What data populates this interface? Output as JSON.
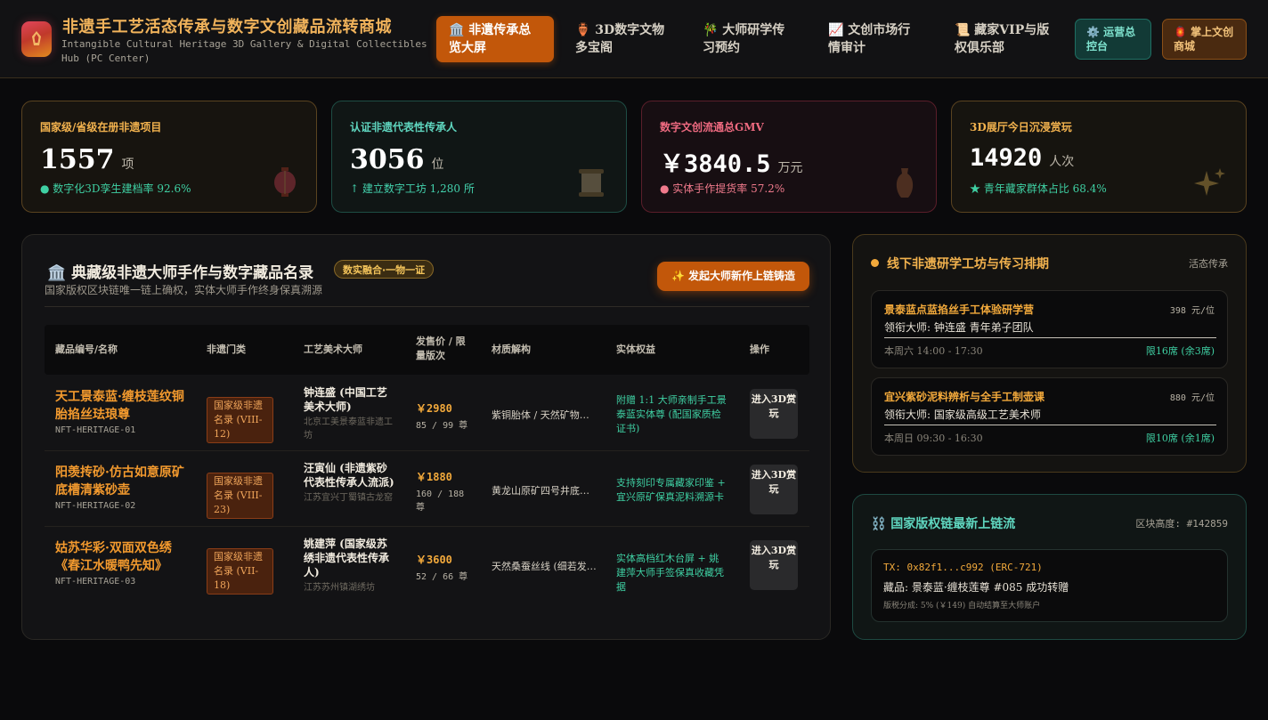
{
  "brand": {
    "title": "非遗手工艺活态传承与数字文创藏品流转商城",
    "subtitle": "Intangible Cultural Heritage 3D Gallery & Digital Collectibles Hub (PC Center)"
  },
  "nav": [
    {
      "label": "🏛️ 非遺传承总览大屏",
      "active": true
    },
    {
      "label": "🏺 3D数字文物多宝阁",
      "active": false
    },
    {
      "label": "🎋 大师研学传习预约",
      "active": false
    },
    {
      "label": "📈 文创市场行情审计",
      "active": false
    },
    {
      "label": "📜 藏家VIP与版权俱乐部",
      "active": false
    }
  ],
  "header_buttons": {
    "ops": "⚙️ 运营总控台",
    "mall": "🏮 掌上文创商城"
  },
  "stats": [
    {
      "label": "国家级/省级在册非遗项目",
      "value": "1557",
      "unit": "项",
      "foot": "● 数字化3D孪生建档率 92.6%",
      "icon": "lantern-icon"
    },
    {
      "label": "认证非遗代表性传承人",
      "value": "3056",
      "unit": "位",
      "foot": "↑ 建立数字工坊 1,280 所",
      "icon": "scroll-icon"
    },
    {
      "label": "数字文创流通总GMV",
      "value": "￥3840.5",
      "unit": "万元",
      "foot": "● 实体手作提货率 57.2%",
      "icon": "vase-icon"
    },
    {
      "label": "3D展厅今日沉浸赏玩",
      "value": "14920",
      "unit": "人次",
      "foot": "★ 青年藏家群体占比 68.4%",
      "icon": "sparkles-icon"
    }
  ],
  "catalog": {
    "title": "🏛️ 典藏级非遗大师手作与数字藏品名录",
    "badge": "数实融合·一物一证",
    "subtitle": "国家版权区块链唯一链上确权，实体大师手作终身保真溯源",
    "cta": "✨ 发起大师新作上链铸造",
    "columns": [
      "藏品编号/名称",
      "非遗门类",
      "工艺美术大师",
      "发售价 / 限量版次",
      "材质解构",
      "实体权益",
      "操作"
    ],
    "rows": [
      {
        "name": "天工景泰蓝·缠枝莲纹铜胎掐丝珐琅尊",
        "code": "NFT-HERITAGE-01",
        "category": "国家级非遗名录 (VIII-12)",
        "master": "钟连盛 (中国工艺美术大师)",
        "studio": "北京工美景泰蓝非遗工坊",
        "price": "￥2980",
        "edition": "85 / 99 尊",
        "material": "紫铜胎体 / 天然矿物彩釉",
        "rights": "附赠 1:1 大师亲制手工景泰蓝实体尊 (配国家质检证书)",
        "action": "进入3D赏玩"
      },
      {
        "name": "阳羡抟砂·仿古如意原矿底槽清紫砂壶",
        "code": "NFT-HERITAGE-02",
        "category": "国家级非遗名录 (VIII-23)",
        "master": "汪寅仙 (非遗紫砂代表性传承人流派)",
        "studio": "江苏宜兴丁蜀镇古龙窑",
        "price": "￥1880",
        "edition": "160 / 188 尊",
        "material": "黄龙山原矿四号井底槽清",
        "rights": "支持刻印专属藏家印鉴 + 宜兴原矿保真泥料溯源卡",
        "action": "进入3D赏玩"
      },
      {
        "name": "姑苏华彩·双面双色绣《春江水暖鸭先知》",
        "code": "NFT-HERITAGE-03",
        "category": "国家级非遗名录 (VII-18)",
        "master": "姚建萍 (国家级苏绣非遗代表性传承人)",
        "studio": "江苏苏州镇湖绣坊",
        "price": "￥3600",
        "edition": "52 / 66 尊",
        "material": "天然桑蚕丝线 (细若发丝)",
        "rights": "实体高档红木台屏 + 姚建萍大师手签保真收藏凭据",
        "action": "进入3D赏玩"
      }
    ]
  },
  "workshops": {
    "title": "线下非遗研学工坊与传习排期",
    "aside": "活态传承",
    "items": [
      {
        "name": "景泰蓝点蓝掐丝手工体验研学营",
        "price": "398 元/位",
        "master": "领衔大师: 钟连盛 青年弟子团队",
        "time": "本周六 14:00 - 17:30",
        "seats": "限16席 (余3席)"
      },
      {
        "name": "宜兴紫砂泥料辨析与全手工制壶课",
        "price": "880 元/位",
        "master": "领衔大师: 国家级高级工艺美术师",
        "time": "本周日 09:30 - 16:30",
        "seats": "限10席 (余1席)"
      }
    ]
  },
  "chain": {
    "title": "⛓️ 国家版权链最新上链流",
    "aside": "区块高度: #142859",
    "tx_hash": "TX: 0x82f1...c992 (ERC-721)",
    "tx_desc": "藏品: 景泰蓝·缠枝莲尊 #085 成功转赠",
    "tx_fee": "版税分成: 5% (￥149) 自动结算至大师账户"
  },
  "colors": {
    "accent": "#c2570a",
    "gold": "#f2a93b",
    "teal": "#3fd0a3",
    "rose": "#ee6a80"
  }
}
